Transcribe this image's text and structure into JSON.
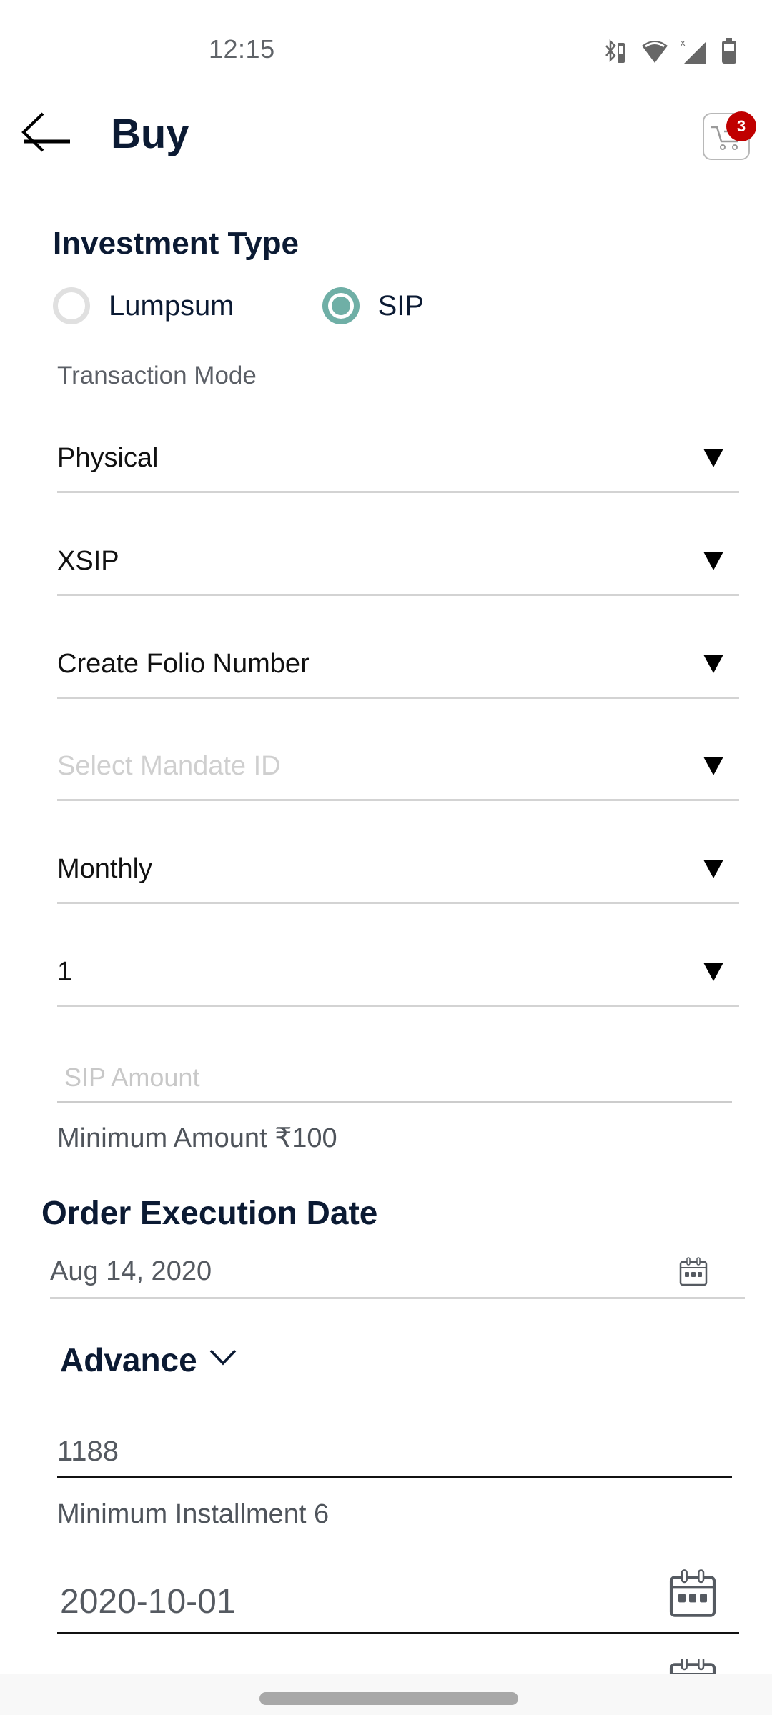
{
  "status_bar": {
    "time": "12:15",
    "icons": [
      "bluetooth-battery-icon",
      "wifi-icon",
      "cellular-no-service-icon",
      "battery-icon"
    ]
  },
  "app_bar": {
    "title": "Buy",
    "back_icon": "arrow-left-icon",
    "cart_icon": "shopping-cart-icon",
    "cart_count": "3"
  },
  "investment_type": {
    "heading": "Investment Type",
    "options": [
      {
        "label": "Lumpsum",
        "selected": false
      },
      {
        "label": "SIP",
        "selected": true
      }
    ]
  },
  "transaction_mode": {
    "label": "Transaction Mode",
    "value": "Physical"
  },
  "dropdowns": {
    "sip_type": {
      "value": "XSIP"
    },
    "folio": {
      "value": "Create Folio Number"
    },
    "mandate": {
      "placeholder": "Select Mandate ID"
    },
    "frequency": {
      "value": "Monthly"
    },
    "sip_date": {
      "value": "1"
    }
  },
  "sip_amount": {
    "placeholder": "SIP Amount",
    "value": "",
    "helper": "Minimum Amount ₹100"
  },
  "order_execution": {
    "heading": "Order Execution Date",
    "date": "Aug 14, 2020",
    "icon": "calendar-icon"
  },
  "advance": {
    "label": "Advance",
    "icon": "chevron-down-icon",
    "installments_value": "1188",
    "installments_helper": "Minimum Installment 6",
    "start_date": "2020-10-01",
    "end_date": ""
  },
  "colors": {
    "accent": "#6fafa6",
    "badge": "#c00000",
    "heading": "#0b1a33"
  }
}
